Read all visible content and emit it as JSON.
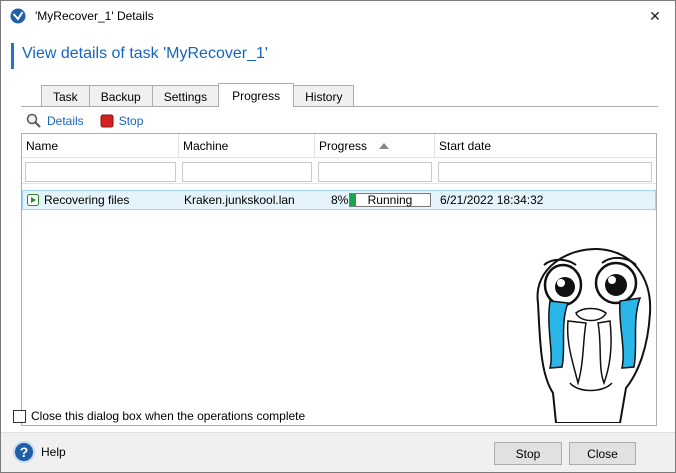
{
  "window": {
    "title": "'MyRecover_1' Details",
    "close_glyph": "✕"
  },
  "header": {
    "title": "View details of task 'MyRecover_1'"
  },
  "tabs": [
    {
      "label": "Task"
    },
    {
      "label": "Backup"
    },
    {
      "label": "Settings"
    },
    {
      "label": "Progress",
      "active": true
    },
    {
      "label": "History"
    }
  ],
  "toolbar": {
    "details_label": "Details",
    "stop_label": "Stop"
  },
  "grid": {
    "columns": [
      {
        "label": "Name"
      },
      {
        "label": "Machine"
      },
      {
        "label": "Progress",
        "sorted": "ascending"
      },
      {
        "label": "Start date"
      }
    ],
    "rows": [
      {
        "name": "Recovering files",
        "machine": "Kraken.junkskool.lan",
        "progress_text": "8%",
        "progress_fraction": 0.08,
        "status": "Running",
        "start_date": "6/21/2022 18:34:32"
      }
    ]
  },
  "options": {
    "close_when_complete_label": "Close this dialog box when the operations complete",
    "close_when_complete_checked": false
  },
  "footer": {
    "help_label": "Help",
    "help_glyph": "?",
    "stop_label": "Stop",
    "close_label": "Close"
  },
  "colors": {
    "accent": "#1565c0",
    "progress": "#17a74a",
    "selection": "#e5f3fb"
  }
}
